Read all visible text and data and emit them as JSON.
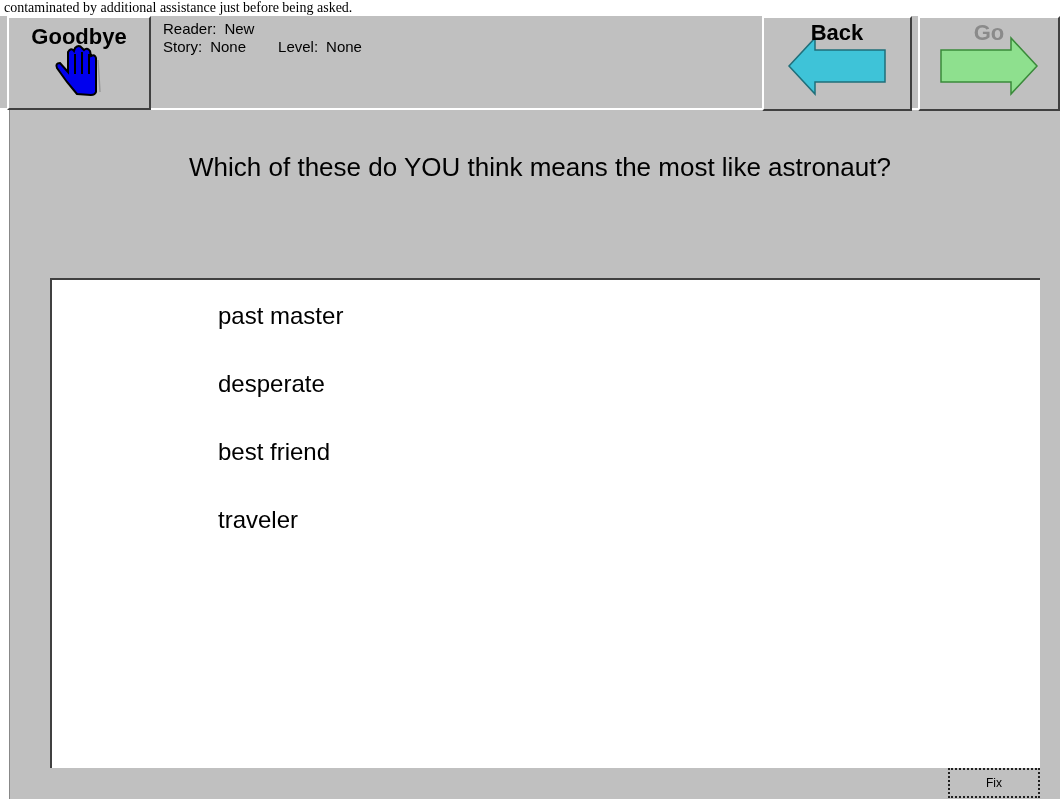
{
  "caption": "contaminated by additional assistance just before being asked.",
  "toolbar": {
    "goodbye": {
      "label": "Goodbye"
    },
    "info": [
      {
        "label": "Reader:",
        "value": "New"
      },
      {
        "label": "Story:",
        "value": "None"
      },
      {
        "label": "Level:",
        "value": "None"
      }
    ],
    "back": {
      "label": "Back",
      "disabled": false
    },
    "go": {
      "label": "Go",
      "disabled": true
    }
  },
  "question": "Which of these do YOU think means the most like astronaut?",
  "options": [
    "past master",
    "desperate",
    "best friend",
    "traveler"
  ],
  "fix_button": "Fix"
}
